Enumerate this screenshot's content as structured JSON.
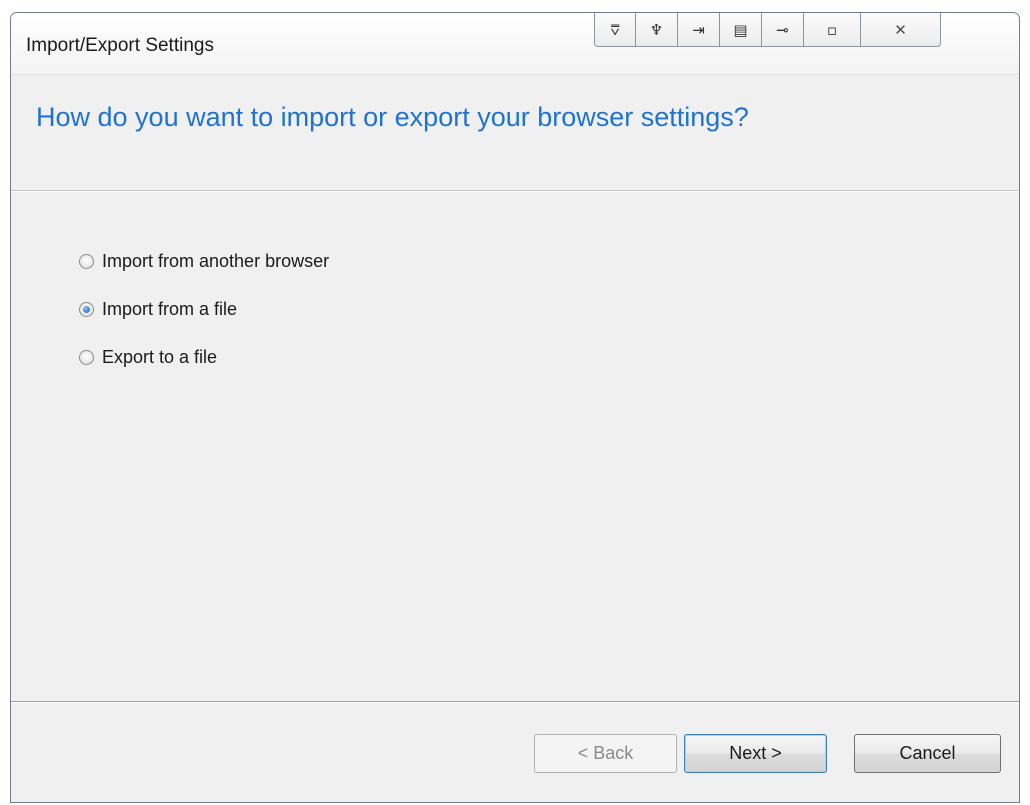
{
  "window": {
    "title": "Import/Export Settings",
    "title_buttons": [
      {
        "icon": "filter-icon",
        "glyph": "⩢"
      },
      {
        "icon": "tool-icon",
        "glyph": "♆"
      },
      {
        "icon": "import-icon",
        "glyph": "⇥"
      },
      {
        "icon": "keyboard-icon",
        "glyph": "▤"
      },
      {
        "icon": "plugin-icon",
        "glyph": "⊸"
      },
      {
        "icon": "restore-icon",
        "glyph": "▫"
      },
      {
        "icon": "close-icon",
        "glyph": "✕"
      }
    ]
  },
  "header": {
    "question": "How do you want to import or export your browser settings?"
  },
  "options": {
    "items": [
      {
        "label": "Import from another browser",
        "checked": false
      },
      {
        "label": "Import from a file",
        "checked": true
      },
      {
        "label": "Export to a file",
        "checked": false
      }
    ]
  },
  "footer": {
    "back_label": "< Back",
    "back_enabled": false,
    "next_label": "Next >",
    "cancel_label": "Cancel"
  },
  "colors": {
    "heading": "#1e73d2",
    "background": "#f0f0f0"
  }
}
